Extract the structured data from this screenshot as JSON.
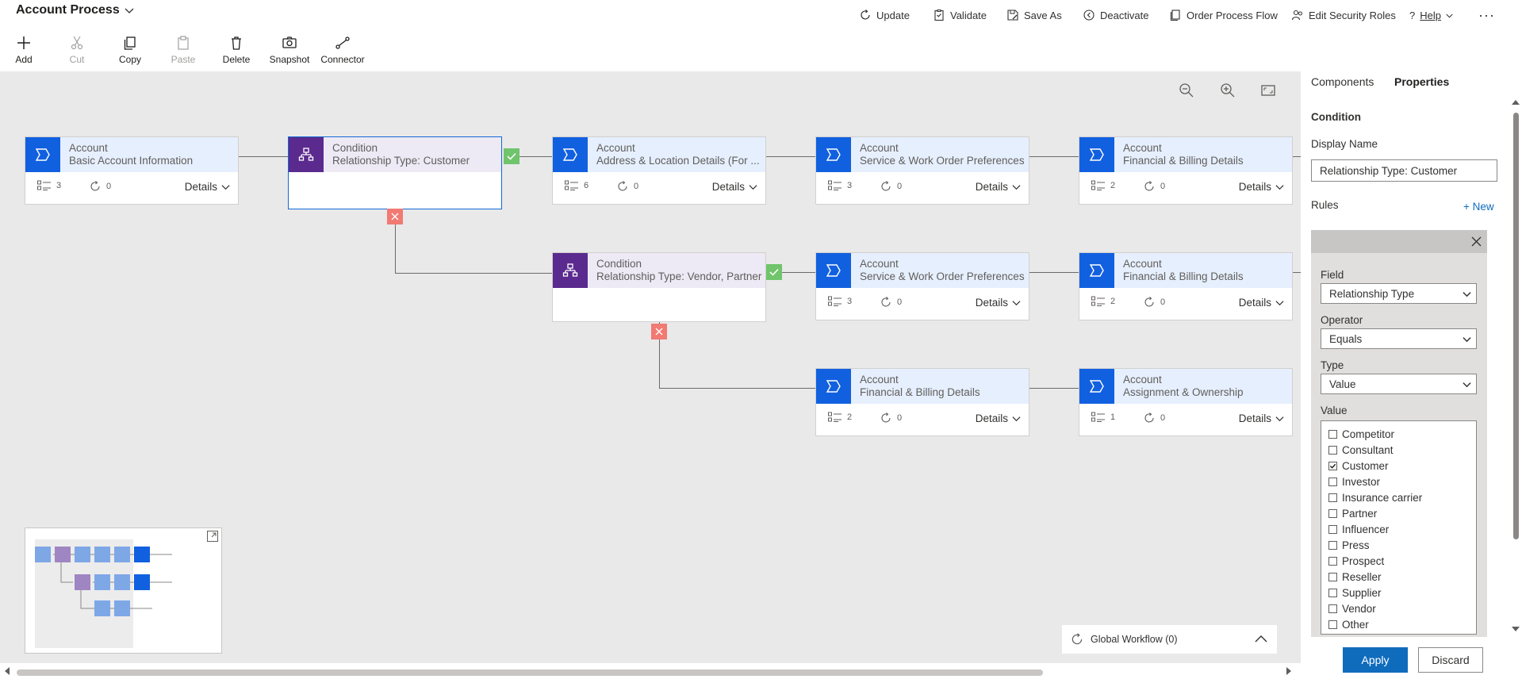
{
  "app": {
    "title": "Account Process"
  },
  "commands": {
    "update": "Update",
    "validate": "Validate",
    "save_as": "Save As",
    "deactivate": "Deactivate",
    "order_process_flow": "Order Process Flow",
    "edit_security_roles": "Edit Security Roles",
    "help": "Help"
  },
  "toolbar": {
    "add": "Add",
    "cut": "Cut",
    "copy": "Copy",
    "paste": "Paste",
    "delete": "Delete",
    "snapshot": "Snapshot",
    "connector": "Connector"
  },
  "nodes": [
    {
      "type": "Account",
      "name": "Basic Account Information",
      "steps": "3",
      "workflows": "0",
      "details": "Details"
    },
    {
      "type": "Condition",
      "name": "Relationship Type: Customer"
    },
    {
      "type": "Account",
      "name": "Address & Location Details (For ...",
      "steps": "6",
      "workflows": "0",
      "details": "Details"
    },
    {
      "type": "Account",
      "name": "Service & Work Order Preferences",
      "steps": "3",
      "workflows": "0",
      "details": "Details"
    },
    {
      "type": "Account",
      "name": "Financial & Billing Details",
      "steps": "2",
      "workflows": "0",
      "details": "Details"
    },
    {
      "type": "Condition",
      "name": "Relationship Type: Vendor, Partner"
    },
    {
      "type": "Account",
      "name": "Service & Work Order Preferences",
      "steps": "3",
      "workflows": "0",
      "details": "Details"
    },
    {
      "type": "Account",
      "name": "Financial & Billing Details",
      "steps": "2",
      "workflows": "0",
      "details": "Details"
    },
    {
      "type": "Account",
      "name": "Financial & Billing Details",
      "steps": "2",
      "workflows": "0",
      "details": "Details"
    },
    {
      "type": "Account",
      "name": "Assignment & Ownership",
      "steps": "1",
      "workflows": "0",
      "details": "Details"
    }
  ],
  "global_workflow": {
    "label": "Global Workflow (0)"
  },
  "panel": {
    "tabs": [
      "Components",
      "Properties"
    ],
    "active_tab": "Properties",
    "section_title": "Condition",
    "display_name_label": "Display Name",
    "display_name_value": "Relationship Type: Customer",
    "rules_label": "Rules",
    "new_label": "+ New",
    "field_label": "Field",
    "field_value": "Relationship Type",
    "operator_label": "Operator",
    "operator_value": "Equals",
    "type_label": "Type",
    "type_value": "Value",
    "value_label": "Value",
    "values": [
      {
        "label": "Competitor",
        "checked": false
      },
      {
        "label": "Consultant",
        "checked": false
      },
      {
        "label": "Customer",
        "checked": true
      },
      {
        "label": "Investor",
        "checked": false
      },
      {
        "label": "Insurance carrier",
        "checked": false
      },
      {
        "label": "Partner",
        "checked": false
      },
      {
        "label": "Influencer",
        "checked": false
      },
      {
        "label": "Press",
        "checked": false
      },
      {
        "label": "Prospect",
        "checked": false
      },
      {
        "label": "Reseller",
        "checked": false
      },
      {
        "label": "Supplier",
        "checked": false
      },
      {
        "label": "Vendor",
        "checked": false
      },
      {
        "label": "Other",
        "checked": false
      }
    ],
    "apply": "Apply",
    "discard": "Discard"
  },
  "colors": {
    "accent": "#1160e0",
    "condition": "#5b2a8e",
    "canvas": "#e9e9e9",
    "true_badge": "#70c46b",
    "false_badge": "#f17a73"
  }
}
